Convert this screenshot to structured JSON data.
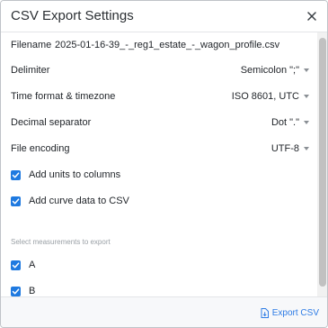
{
  "dialog": {
    "title": "CSV Export Settings",
    "close_icon": "close-icon"
  },
  "filename": {
    "label": "Filename",
    "value": "2025-01-16-39_-_reg1_estate_-_wagon_profile.csv"
  },
  "settings": [
    {
      "label": "Delimiter",
      "value": "Semicolon \";\""
    },
    {
      "label": "Time format & timezone",
      "value": "ISO 8601, UTC"
    },
    {
      "label": "Decimal separator",
      "value": "Dot \".\""
    },
    {
      "label": "File encoding",
      "value": "UTF-8"
    }
  ],
  "options": [
    {
      "label": "Add units to columns",
      "checked": true
    },
    {
      "label": "Add curve data to CSV",
      "checked": true
    }
  ],
  "measurements": {
    "section_label": "Select measurements to export",
    "items": [
      {
        "label": "A",
        "checked": true
      },
      {
        "label": "B",
        "checked": true
      }
    ]
  },
  "footer": {
    "export_label": "Export CSV",
    "export_icon": "download-file-icon"
  },
  "colors": {
    "accent": "#1f7ae0",
    "link": "#2d7be5"
  }
}
